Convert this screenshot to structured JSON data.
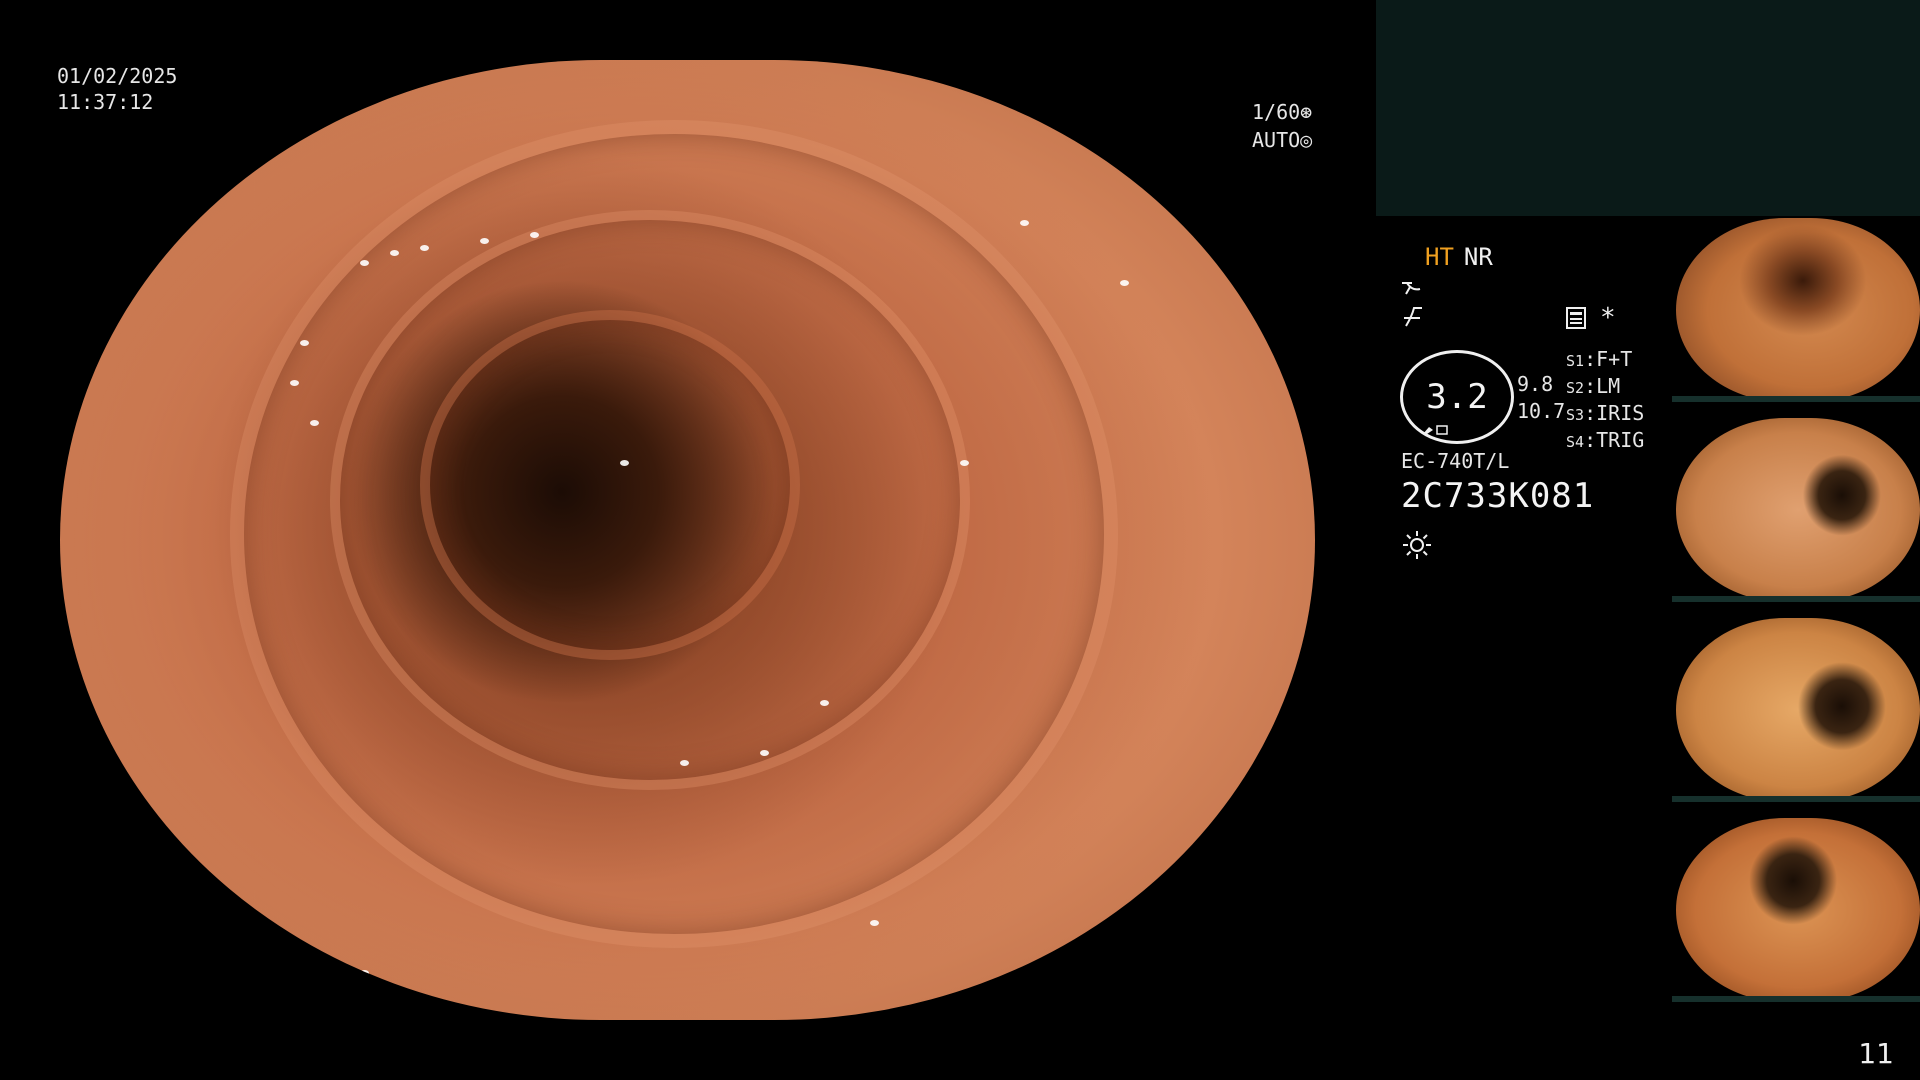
{
  "overlay": {
    "date": "01/02/2025",
    "time": "11:37:12",
    "shutter": "1/60",
    "iris": "AUTO"
  },
  "info_panel": {
    "ht_label": "HT",
    "nr_label": "NR",
    "zoom_value": "3.2",
    "zoom_side_top": "9.8",
    "zoom_side_bottom": "10.7",
    "scope_model": "EC-740T/L",
    "scope_serial": "2C733K081",
    "switches": [
      {
        "key": "S1",
        "value": "F+T"
      },
      {
        "key": "S2",
        "value": "LM"
      },
      {
        "key": "S3",
        "value": "IRIS"
      },
      {
        "key": "S4",
        "value": "TRIG"
      }
    ],
    "asterisk": "*"
  },
  "thumbnails": [
    {
      "name": "thumbnail-1"
    },
    {
      "name": "thumbnail-2"
    },
    {
      "name": "thumbnail-3"
    },
    {
      "name": "thumbnail-4"
    }
  ],
  "page_number": "11",
  "colors": {
    "ht_accent": "#f0a020",
    "status_panel": "#0a1a18",
    "mucosa": "#c06a45"
  }
}
